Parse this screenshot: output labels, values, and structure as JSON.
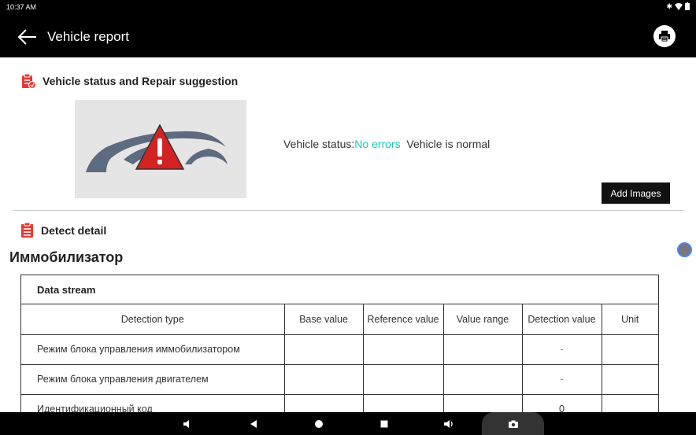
{
  "statusbar": {
    "time": "10:37 AM"
  },
  "header": {
    "title": "Vehicle report"
  },
  "section1": {
    "title": "Vehicle status and Repair suggestion"
  },
  "status": {
    "label": "Vehicle status:",
    "value": "No errors",
    "message": "Vehicle is normal"
  },
  "buttons": {
    "add_images": "Add Images"
  },
  "section2": {
    "title": "Detect detail"
  },
  "module": {
    "name": "Иммобилизатор"
  },
  "table": {
    "caption": "Data stream",
    "columns": [
      "Detection type",
      "Base value",
      "Reference value",
      "Value range",
      "Detection value",
      "Unit"
    ],
    "rows": [
      {
        "type": "Режим блока управления иммобилизатором",
        "base": "",
        "reference": "",
        "range": "",
        "detection": "-",
        "unit": ""
      },
      {
        "type": "Режим блока управления двигателем",
        "base": "",
        "reference": "",
        "range": "",
        "detection": "-",
        "unit": ""
      },
      {
        "type": "Идентификационный код",
        "base": "",
        "reference": "",
        "range": "",
        "detection": "0",
        "unit": ""
      }
    ]
  },
  "colors": {
    "accent": "#1ec5ba",
    "icon_red": "#e53935",
    "bar": "#000000"
  }
}
